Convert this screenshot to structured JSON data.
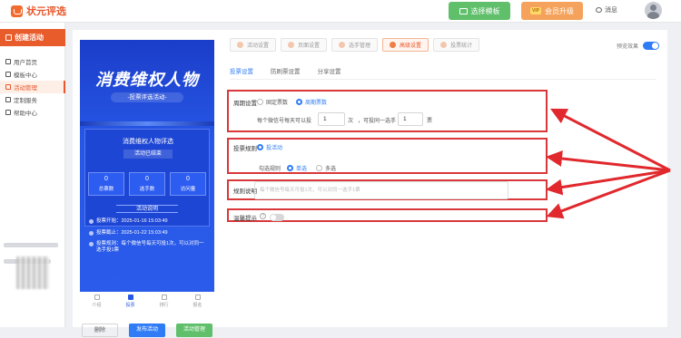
{
  "brand": {
    "name": "状元评选",
    "color": "#e8562a"
  },
  "topbar": {
    "choose_template": "选择模板",
    "vip_badge": "VIP",
    "vip_upgrade": "会员升级",
    "messages": "消息"
  },
  "sidebar": {
    "create_activity": "创建活动",
    "items": [
      {
        "label": "用户首页",
        "icon": "home-icon"
      },
      {
        "label": "模板中心",
        "icon": "template-icon"
      },
      {
        "label": "活动管理",
        "icon": "list-icon",
        "active": true
      },
      {
        "label": "定制服务",
        "icon": "service-icon"
      },
      {
        "label": "帮助中心",
        "icon": "help-icon"
      }
    ]
  },
  "poster": {
    "title": "消费维权人物",
    "subtitle": "-投票评选活动-",
    "card_title": "消费维权人物评选",
    "status": "活动已结束",
    "stats": [
      {
        "value": "0",
        "label": "总票数"
      },
      {
        "value": "0",
        "label": "选手数"
      },
      {
        "value": "0",
        "label": "访问量"
      }
    ],
    "rules_heading": "活动说明",
    "rules": [
      "投票开始：2025-01-16 15:03:49",
      "投票截止：2025-01-22 15:03:49",
      "投票规则：每个微信号每天可投1次，可以对同一选手投1票"
    ],
    "tabs": [
      "介绍",
      "投票",
      "排行",
      "报名"
    ],
    "active_tab_index": 1
  },
  "phone_actions": {
    "delete": "删除",
    "publish": "发布活动",
    "manage": "活动管理"
  },
  "steps": [
    {
      "label": "活动设置",
      "active": false
    },
    {
      "label": "页面设置",
      "active": false
    },
    {
      "label": "选手管理",
      "active": false
    },
    {
      "label": "高级设置",
      "active": true
    },
    {
      "label": "投票统计",
      "active": false
    }
  ],
  "preview_toggle": {
    "label": "预览效果",
    "on": true
  },
  "subtabs": [
    {
      "label": "投票设置",
      "active": true
    },
    {
      "label": "防刷票设置",
      "active": false
    },
    {
      "label": "分享设置",
      "active": false
    }
  ],
  "settings": {
    "cycle": {
      "label": "周期设置",
      "options": [
        "固定票数",
        "周期票数"
      ],
      "selected": 1,
      "daily_prefix": "每个微信号每天可以投",
      "daily_value": "1",
      "daily_unit": "次",
      "per_player_prefix": "，可投同一选手",
      "per_player_value": "1",
      "per_player_unit": "票"
    },
    "vote_rule": {
      "label": "投票规则",
      "option": "投活动",
      "select_label": "勾选规则",
      "select_options": [
        "单选",
        "多选"
      ],
      "selected": 0
    },
    "rule_desc": {
      "label": "规则说明",
      "placeholder": "每个微信号每天可投1次，可以对同一选手1票"
    },
    "warm_tip": {
      "label": "温馨提示",
      "help": "?",
      "on": false
    }
  },
  "colors": {
    "highlight": "#d9373a",
    "accent": "#2f7cf6",
    "poster_blue": "#2757e6"
  }
}
